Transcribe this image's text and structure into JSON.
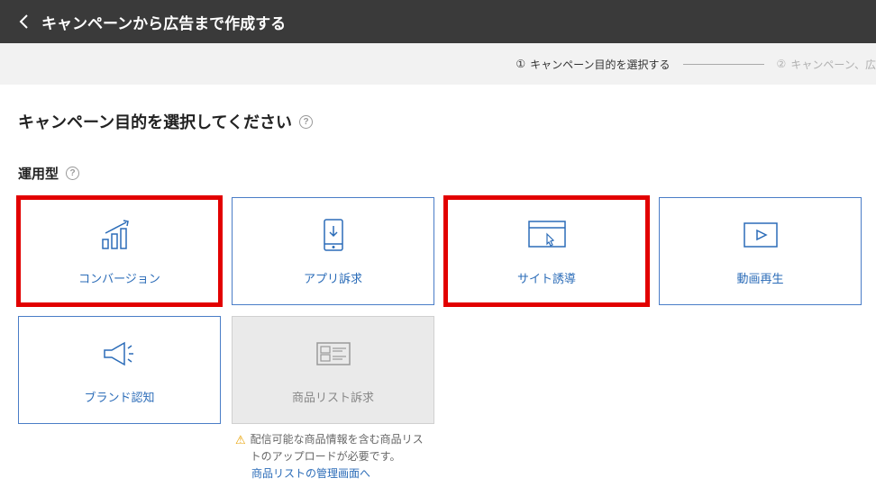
{
  "header": {
    "title": "キャンペーンから広告まで作成する"
  },
  "stepper": {
    "step1_num": "①",
    "step1_label": "キャンペーン目的を選択する",
    "step2_num": "②",
    "step2_label": "キャンペーン、広"
  },
  "section": {
    "title": "キャンペーン目的を選択してください"
  },
  "subsection": {
    "title": "運用型"
  },
  "cards": {
    "conversion": "コンバージョン",
    "app_appeal": "アプリ訴求",
    "site_guide": "サイト誘導",
    "video_play": "動画再生",
    "brand_aware": "ブランド認知",
    "product_list": "商品リスト訴求"
  },
  "notice": {
    "text": "配信可能な商品情報を含む商品リストのアップロードが必要です。",
    "link": "商品リストの管理画面へ"
  }
}
